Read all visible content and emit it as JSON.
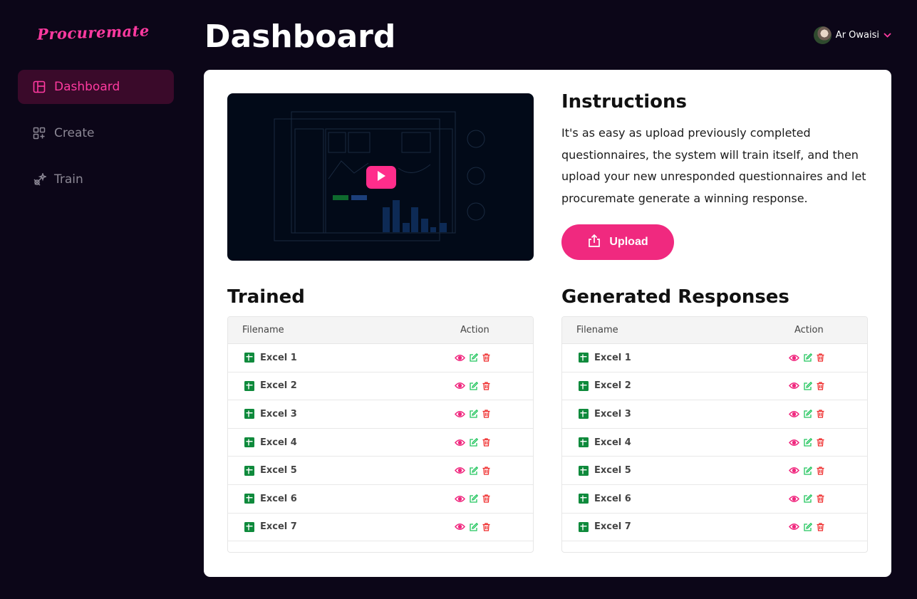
{
  "brand": {
    "logo_text": "Procuremate"
  },
  "sidebar": {
    "items": [
      {
        "label": "Dashboard",
        "icon": "dashboard-icon",
        "active": true
      },
      {
        "label": "Create",
        "icon": "create-icon",
        "active": false
      },
      {
        "label": "Train",
        "icon": "train-icon",
        "active": false
      }
    ]
  },
  "header": {
    "title": "Dashboard"
  },
  "user": {
    "name": "Ar Owaisi"
  },
  "instructions": {
    "title": "Instructions",
    "text": "It's as easy as upload previously completed questionnaires, the system will train itself, and then upload your new unresponded questionnaires and let procuremate generate a winning response.",
    "upload_label": "Upload"
  },
  "video": {
    "play_icon": "play-icon"
  },
  "trained": {
    "title": "Trained",
    "col_filename": "Filename",
    "col_action": "Action",
    "rows": [
      "Excel 1",
      "Excel 2",
      "Excel 3",
      "Excel 4",
      "Excel 5",
      "Excel 6",
      "Excel 7"
    ]
  },
  "generated": {
    "title": "Generated Responses",
    "col_filename": "Filename",
    "col_action": "Action",
    "rows": [
      "Excel 1",
      "Excel 2",
      "Excel 3",
      "Excel 4",
      "Excel 5",
      "Excel 6",
      "Excel 7"
    ]
  },
  "colors": {
    "accent": "#ff2d8b",
    "view": "#f0297f",
    "edit": "#22c55e",
    "delete": "#ef2b2b",
    "sheet": "#0f8a3c"
  }
}
